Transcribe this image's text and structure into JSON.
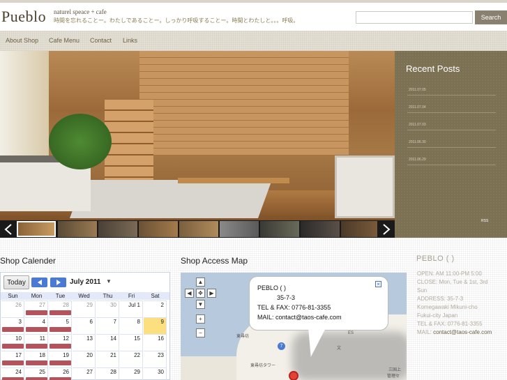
{
  "site": {
    "logo": "Pueblo",
    "tagline_en": "naturel speace + cafe",
    "tagline_jp": "時間を忘れることー。わたしであることー。しっかり呼吸することー。時間とわたしと。。。呼吸。"
  },
  "search": {
    "placeholder": "",
    "button_label": "Search"
  },
  "nav": [
    {
      "label": "About Shop"
    },
    {
      "label": "Cafe Menu"
    },
    {
      "label": "Contact"
    },
    {
      "label": "Links"
    }
  ],
  "recent_posts": {
    "title": "Recent Posts",
    "items": [
      "2011.07.05",
      "2011.07.04",
      "2011.07.03",
      "2011.06.30",
      "2011.06.29"
    ],
    "rss_label": "RSS"
  },
  "slider": {
    "prev_icon": "arrow-left-icon",
    "next_icon": "arrow-right-icon",
    "thumb_count": 9,
    "active_index": 0
  },
  "calendar": {
    "title": "Shop Calender",
    "today_label": "Today",
    "month_label": "July 2011",
    "weekdays": [
      "Sun",
      "Mon",
      "Tue",
      "Wed",
      "Thu",
      "Fri",
      "Sat"
    ],
    "weeks": [
      [
        {
          "d": "26",
          "o": true,
          "e": false
        },
        {
          "d": "27",
          "o": true,
          "e": true
        },
        {
          "d": "28",
          "o": true,
          "e": true
        },
        {
          "d": "29",
          "o": true,
          "e": false
        },
        {
          "d": "30",
          "o": true,
          "e": false
        },
        {
          "d": "Jul 1",
          "o": false,
          "e": false
        },
        {
          "d": "2",
          "o": false,
          "e": false
        }
      ],
      [
        {
          "d": "3",
          "o": false,
          "e": true
        },
        {
          "d": "4",
          "o": false,
          "e": true
        },
        {
          "d": "5",
          "o": false,
          "e": true
        },
        {
          "d": "6",
          "o": false,
          "e": false
        },
        {
          "d": "7",
          "o": false,
          "e": false
        },
        {
          "d": "8",
          "o": false,
          "e": false
        },
        {
          "d": "9",
          "o": false,
          "e": false,
          "t": true
        }
      ],
      [
        {
          "d": "10",
          "o": false,
          "e": true
        },
        {
          "d": "11",
          "o": false,
          "e": true
        },
        {
          "d": "12",
          "o": false,
          "e": true
        },
        {
          "d": "13",
          "o": false,
          "e": false
        },
        {
          "d": "14",
          "o": false,
          "e": false
        },
        {
          "d": "15",
          "o": false,
          "e": false
        },
        {
          "d": "16",
          "o": false,
          "e": false
        }
      ],
      [
        {
          "d": "17",
          "o": false,
          "e": true
        },
        {
          "d": "18",
          "o": false,
          "e": true
        },
        {
          "d": "19",
          "o": false,
          "e": true
        },
        {
          "d": "20",
          "o": false,
          "e": false
        },
        {
          "d": "21",
          "o": false,
          "e": false
        },
        {
          "d": "22",
          "o": false,
          "e": false
        },
        {
          "d": "23",
          "o": false,
          "e": false
        }
      ],
      [
        {
          "d": "24",
          "o": false,
          "e": true
        },
        {
          "d": "25",
          "o": false,
          "e": true
        },
        {
          "d": "26",
          "o": false,
          "e": true
        },
        {
          "d": "27",
          "o": false,
          "e": false
        },
        {
          "d": "28",
          "o": false,
          "e": false
        },
        {
          "d": "29",
          "o": false,
          "e": false
        },
        {
          "d": "30",
          "o": false,
          "e": false
        }
      ]
    ],
    "event_color": "#b4535b",
    "today_color": "#fcdf7e"
  },
  "map": {
    "title": "Shop Access Map",
    "bubble": {
      "name": "PEBLO (   )",
      "address": "35-7-3",
      "tel": "TEL & FAX: 0776-81-3355",
      "mail": "MAIL: contact@taos-cafe.com"
    },
    "labels": [
      "東尋坊",
      "東尋坊タワー",
      "文",
      "三国上",
      "管理セ",
      "ES"
    ],
    "route_badge": "7"
  },
  "shop_info": {
    "title": "PEBLO (   )",
    "lines": [
      "OPEN: AM 11:00-PM 5:00",
      "CLOSE: Mon, Tue & 1st, 3rd",
      "Sun",
      "ADDRESS: 35-7-3",
      "Komegawaki Mikuni-cho",
      "Fukui-city Japan",
      "TEL & FAX: 0776-81-3355"
    ],
    "mail_prefix": "MAIL:",
    "mail": "contact@taos-cafe.com"
  },
  "colors": {
    "accent": "#7d7154",
    "nav_text": "#6b5f44",
    "button": "#8a8070"
  }
}
